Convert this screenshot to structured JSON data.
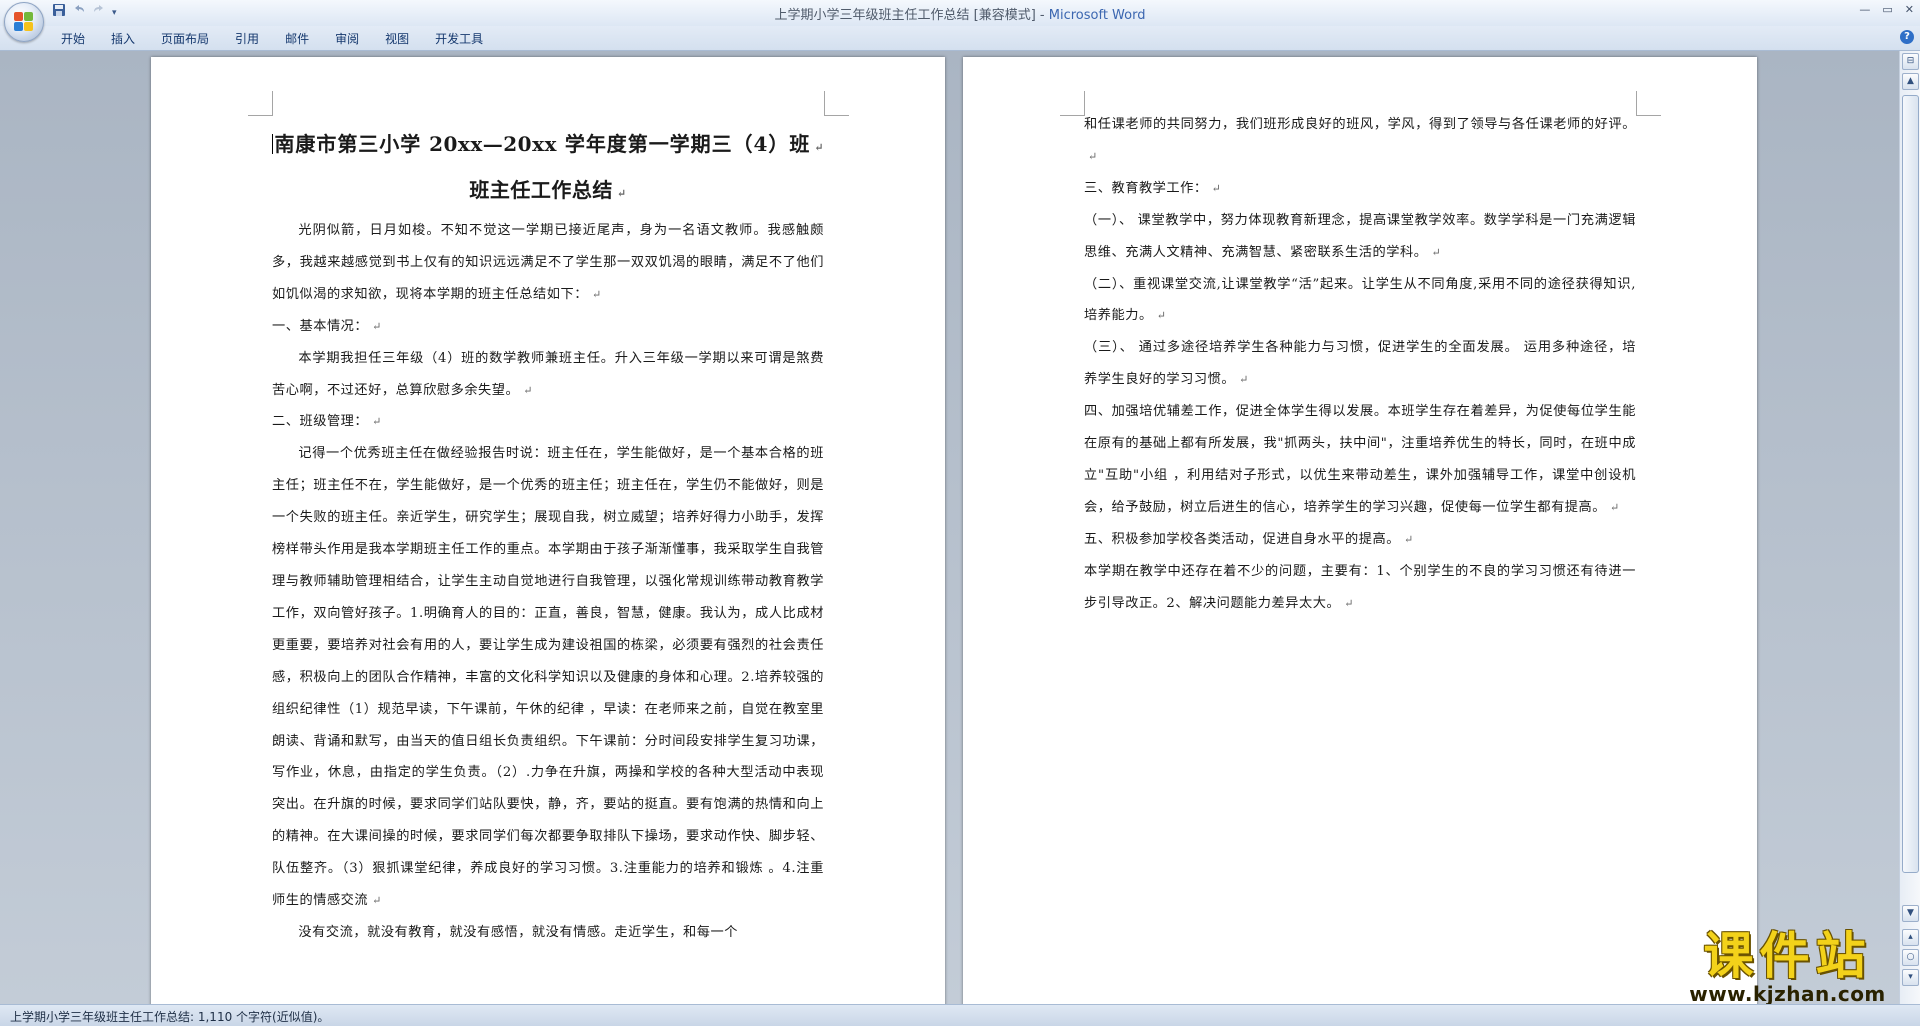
{
  "window": {
    "title": "上学期小学三年级班主任工作总结 [兼容模式] - ",
    "app_name": "Microsoft Word"
  },
  "quick_access": {
    "save_icon": "save-icon",
    "undo_icon": "undo-icon",
    "redo_icon": "redo-icon"
  },
  "ribbon": {
    "tabs": [
      "开始",
      "插入",
      "页面布局",
      "引用",
      "邮件",
      "审阅",
      "视图",
      "开发工具"
    ]
  },
  "page1": {
    "title_line1": "南康市第三小学 20xx—20xx 学年度第一学期三（4）班",
    "title_line2": "班主任工作总结",
    "paragraphs": [
      "光阴似箭，日月如梭。不知不觉这一学期已接近尾声，身为一名语文教师。我感触颇多，我越来越感觉到书上仅有的知识远远满足不了学生那一双双饥渴的眼睛，满足不了他们如饥似渴的求知欲，现将本学期的班主任总结如下：",
      "一、基本情况：",
      "本学期我担任三年级（4）班的数学教师兼班主任。升入三年级一学期以来可谓是煞费苦心啊，不过还好，总算欣慰多余失望。",
      "二、班级管理：",
      "记得一个优秀班主任在做经验报告时说：班主任在，学生能做好，是一个基本合格的班主任；班主任不在，学生能做好，是一个优秀的班主任；班主任在，学生仍不能做好，则是一个失败的班主任。亲近学生，研究学生；展现自我，树立威望；培养好得力小助手，发挥榜样带头作用是我本学期班主任工作的重点。本学期由于孩子渐渐懂事，我采取学生自我管理与教师辅助管理相结合，让学生主动自觉地进行自我管理，以强化常规训练带动教育教学工作，双向管好孩子。1.明确育人的目的：正直，善良，智慧，健康。我认为，成人比成材更重要，要培养对社会有用的人，要让学生成为建设祖国的栋梁，必须要有强烈的社会责任感，积极向上的团队合作精神，丰富的文化科学知识以及健康的身体和心理。2.培养较强的组织纪律性（1）规范早读，下午课前，午休的纪律 ，早读：在老师来之前，自觉在教室里朗读、背诵和默写，由当天的值日组长负责组织。下午课前：分时间段安排学生复习功课，写作业，休息，由指定的学生负责。（2）.力争在升旗，两操和学校的各种大型活动中表现突出。在升旗的时候，要求同学们站队要快，静，齐，要站的挺直。要有饱满的热情和向上的精神。在大课间操的时候，要求同学们每次都要争取排队下操场，要求动作快、脚步轻、队伍整齐。（3）狠抓课堂纪律，养成良好的学习习惯。3.注重能力的培养和锻炼 。4.注重师生的情感交流",
      "没有交流，就没有教育，就没有感悟，就没有情感。走近学生，和每一个"
    ]
  },
  "page2": {
    "paragraphs": [
      "和任课老师的共同努力，我们班形成良好的班风，学风，得到了领导与各任课老师的好评。",
      "三、教育教学工作：",
      "（一）、 课堂教学中，努力体现教育新理念，提高课堂教学效率。数学学科是一门充满逻辑思维、充满人文精神、充满智慧、紧密联系生活的学科。",
      "（二）、重视课堂交流,让课堂教学“活”起来。让学生从不同角度,采用不同的途径获得知识,培养能力。",
      "（三）、 通过多途径培养学生各种能力与习惯，促进学生的全面发展。   运用多种途径，培养学生良好的学习习惯。",
      "四、加强培优辅差工作，促进全体学生得以发展。本班学生存在着差异，为促使每位学生能在原有的基础上都有所发展，我\"抓两头，扶中间\"，注重培养优生的特长，同时，在班中成立\"互助\"小组 ，利用结对子形式，以优生来带动差生，课外加强辅导工作，课堂中创设机会，给予鼓励，树立后进生的信心，培养学生的学习兴趣，促使每一位学生都有提高。",
      "五、积极参加学校各类活动，促进自身水平的提高。",
      "本学期在教学中还存在着不少的问题，主要有：1、个别学生的不良的学习习惯还有待进一步引导改正。2、解决问题能力差异太大。"
    ]
  },
  "para_mark": "↵",
  "status": {
    "text": "上学期小学三年级班主任工作总结: 1,110 个字符(近似值)。"
  },
  "watermark": {
    "logo": "课件站",
    "url": "www.kjzhan.com"
  },
  "colors": {
    "accent": "#3b66b0",
    "ribbon": "#dbe5f2",
    "workspace": "#b9c3cf"
  }
}
